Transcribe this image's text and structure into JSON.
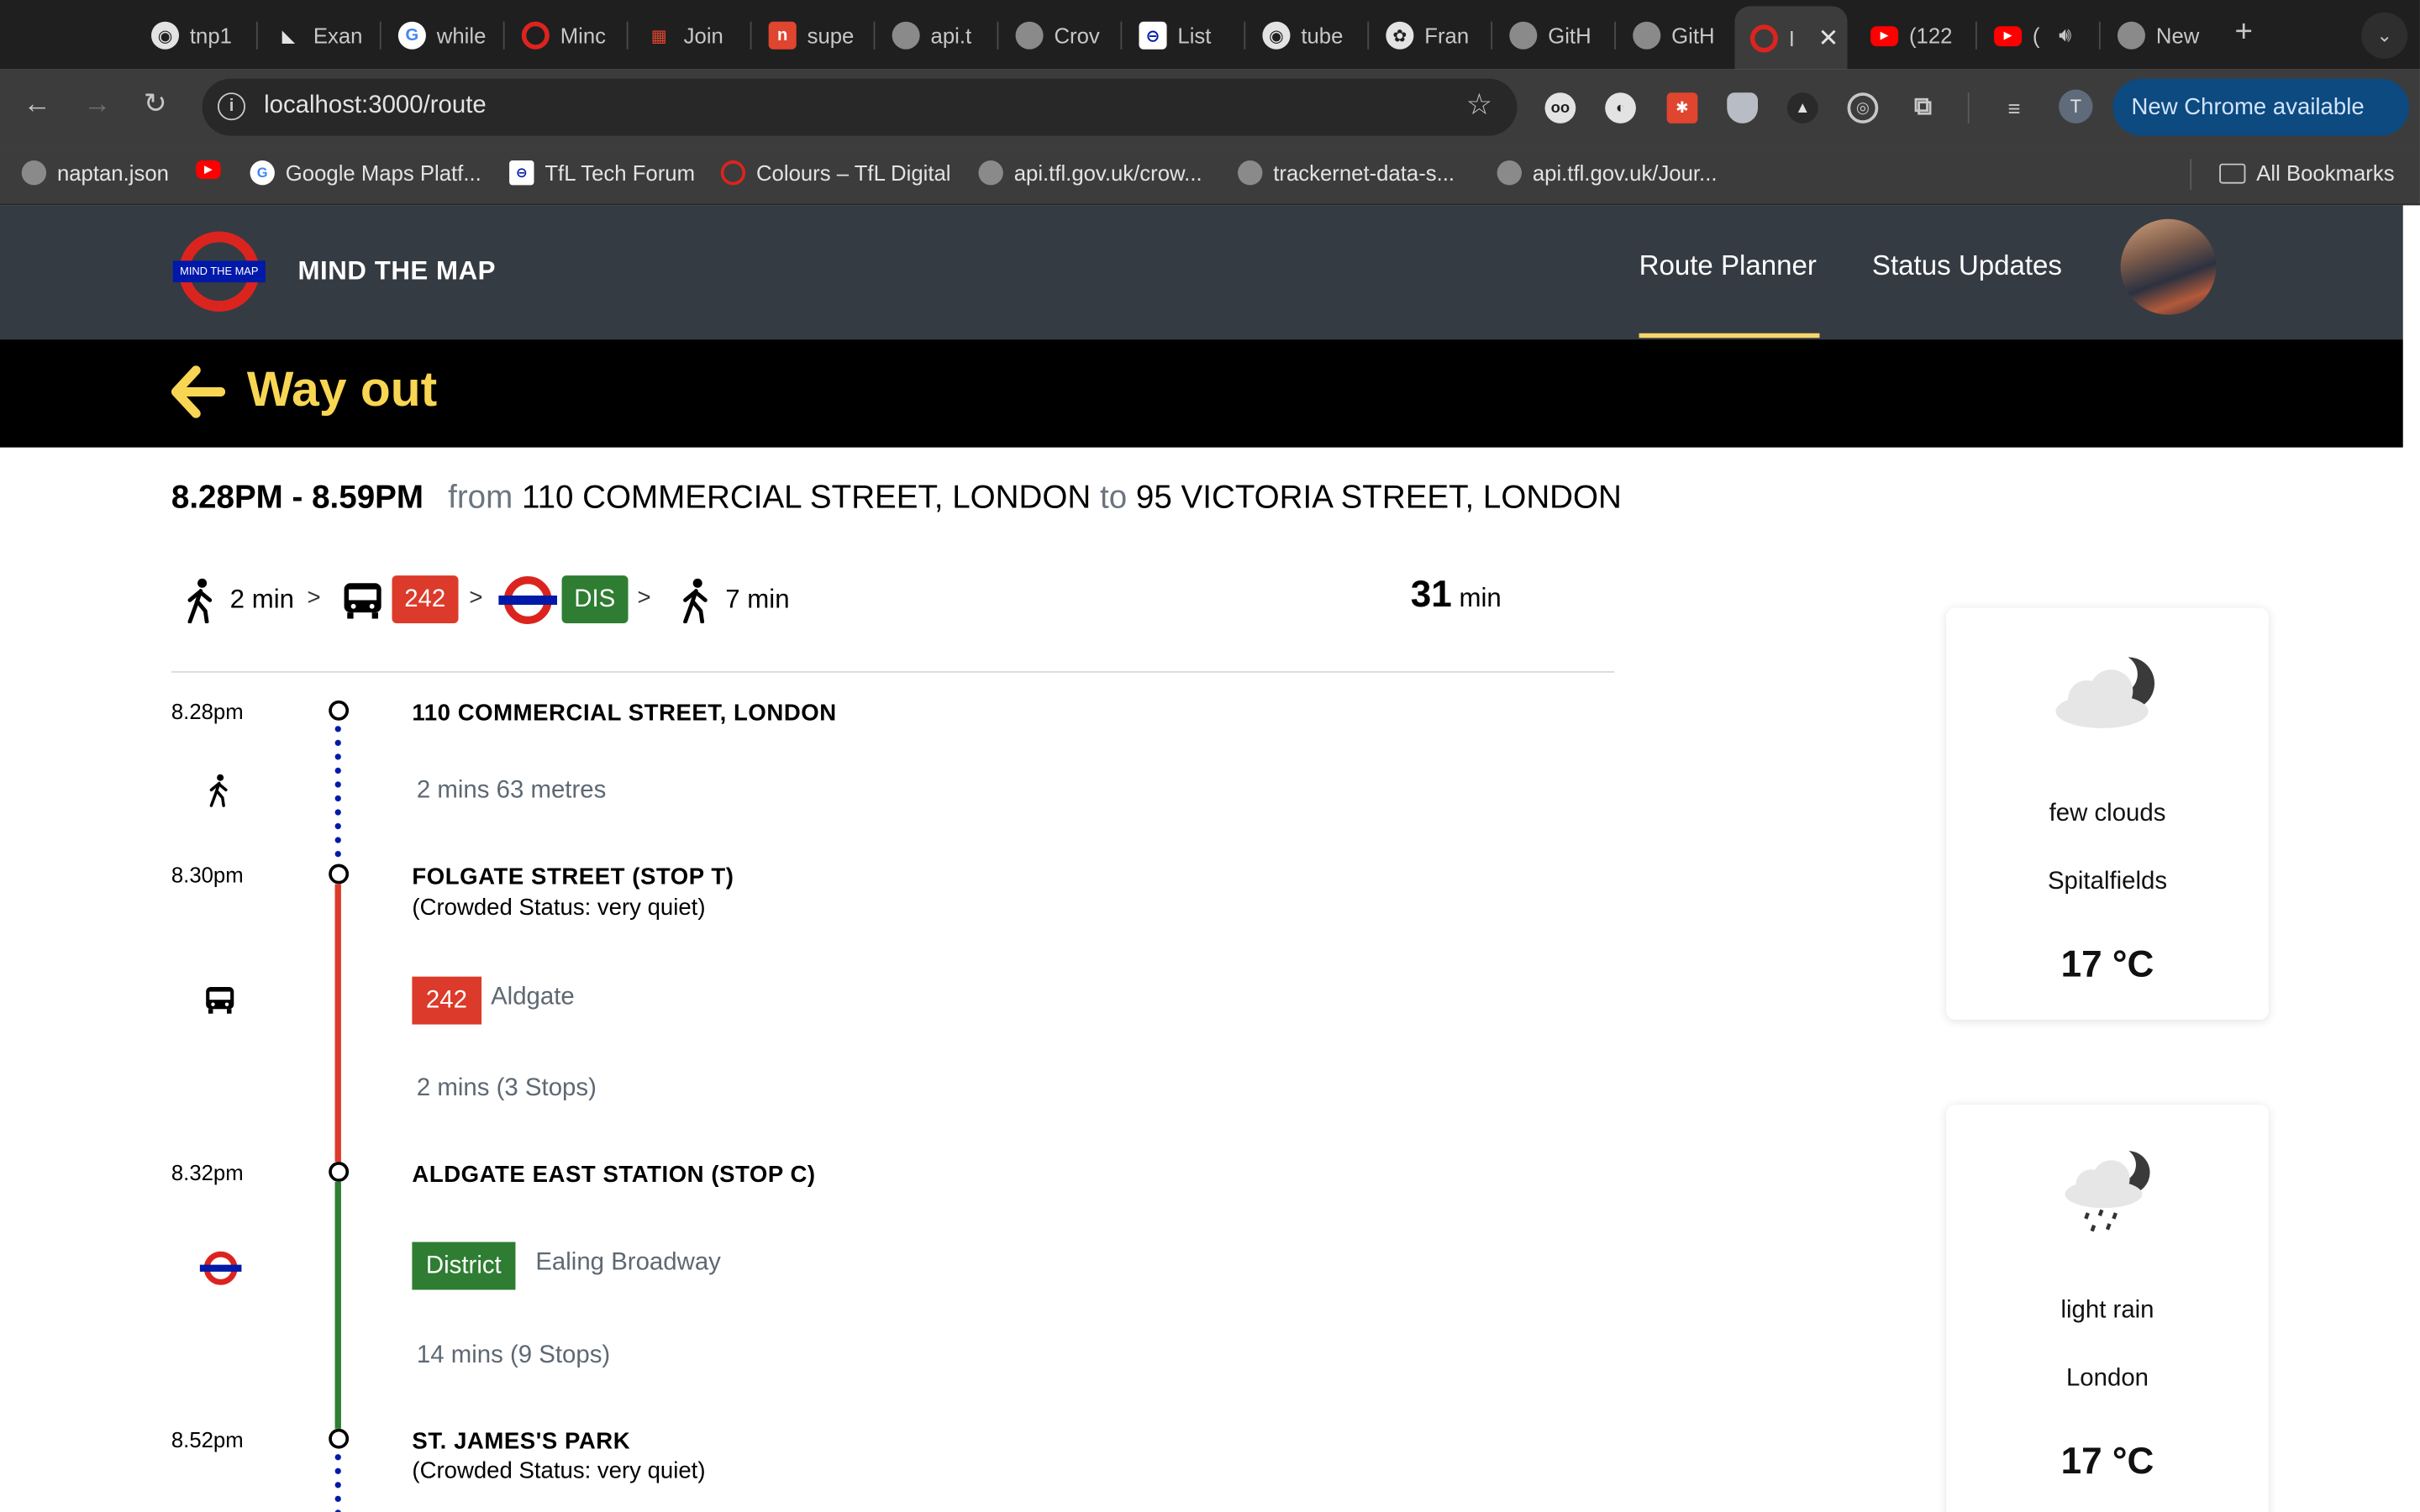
{
  "browser": {
    "tabs": [
      {
        "title": "tnp1",
        "icon": "github-icon"
      },
      {
        "title": "Exan",
        "icon": "framer-icon"
      },
      {
        "title": "while",
        "icon": "google-icon"
      },
      {
        "title": "Minc",
        "icon": "tfl-roundel-icon"
      },
      {
        "title": "Join",
        "icon": "brand-icon"
      },
      {
        "title": "supe",
        "icon": "brand-icon"
      },
      {
        "title": "api.t",
        "icon": "globe-icon"
      },
      {
        "title": "Crov",
        "icon": "globe-icon"
      },
      {
        "title": "List",
        "icon": "tfl-roundel-icon"
      },
      {
        "title": "tube",
        "icon": "github-icon"
      },
      {
        "title": "Fran",
        "icon": "openai-icon"
      },
      {
        "title": "GitH",
        "icon": "globe-icon"
      },
      {
        "title": "GitH",
        "icon": "globe-icon"
      },
      {
        "title": "I",
        "icon": "tfl-roundel-icon",
        "active": true
      },
      {
        "title": "(122",
        "icon": "youtube-icon"
      },
      {
        "title": "(",
        "icon": "youtube-icon"
      },
      {
        "title": "New",
        "icon": "chrome-icon"
      }
    ],
    "url": "localhost:3000/route",
    "update_label": "New Chrome available",
    "profile_initial": "T",
    "bookmarks": [
      {
        "label": "naptan.json",
        "icon": "globe-icon"
      },
      {
        "label": "",
        "icon": "youtube-icon"
      },
      {
        "label": "Google Maps Platf...",
        "icon": "google-icon"
      },
      {
        "label": "TfL Tech Forum",
        "icon": "tfl-icon"
      },
      {
        "label": "Colours – TfL Digital",
        "icon": "tfl-roundel-icon"
      },
      {
        "label": "api.tfl.gov.uk/crow...",
        "icon": "globe-icon"
      },
      {
        "label": "trackernet-data-s...",
        "icon": "globe-icon"
      },
      {
        "label": "api.tfl.gov.uk/Jour...",
        "icon": "globe-icon"
      }
    ],
    "all_bookmarks": "All Bookmarks"
  },
  "app": {
    "logo_text": "MIND THE MAP",
    "brand": "MIND THE MAP",
    "nav": {
      "route_planner": "Route Planner",
      "status_updates": "Status Updates"
    },
    "banner_title": "Way out"
  },
  "route": {
    "times": "8.28PM - 8.59PM",
    "from_kw": "from",
    "from": "110 COMMERCIAL STREET, LONDON",
    "to_kw": "to",
    "to": "95 VICTORIA STREET, LONDON",
    "legs_summary": {
      "walk1": "2 min",
      "bus": "242",
      "tube": "DIS",
      "walk2": "7 min",
      "separator": ">"
    },
    "total_value": "31",
    "total_unit": "min",
    "stops": [
      {
        "time": "8.28pm",
        "name": "110 COMMERCIAL STREET, LONDON",
        "sub": ""
      },
      {
        "time": "8.30pm",
        "name": "FOLGATE STREET (STOP T)",
        "sub": "(Crowded Status: very quiet)"
      },
      {
        "time": "8.32pm",
        "name": "ALDGATE EAST STATION (STOP C)",
        "sub": ""
      },
      {
        "time": "8.52pm",
        "name": "ST. JAMES'S PARK",
        "sub": "(Crowded Status: very quiet)"
      }
    ],
    "leg_details": {
      "walk": "2 mins 63 metres",
      "bus_badge": "242",
      "bus_dest": "Aldgate",
      "bus_duration": "2 mins (3 Stops)",
      "tube_badge": "District",
      "tube_dest": "Ealing Broadway",
      "tube_duration": "14 mins (9 Stops)"
    }
  },
  "weather": [
    {
      "desc": "few clouds",
      "place": "Spitalfields",
      "temp": "17 °C",
      "icon": "night-cloud-icon"
    },
    {
      "desc": "light rain",
      "place": "London",
      "temp": "17 °C",
      "icon": "night-rain-icon"
    }
  ],
  "colors": {
    "header_bg": "#353b43",
    "banner_bg": "#000000",
    "banner_text": "#f8d653",
    "bus_red": "#dc3a2a",
    "district_green": "#2e7d32",
    "walk_dots": "#0019a8"
  }
}
